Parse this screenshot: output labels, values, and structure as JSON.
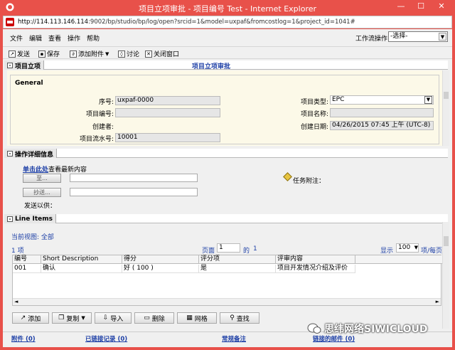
{
  "window": {
    "title": "项目立项审批 - 项目编号 Test - Internet Explorer",
    "minimize": "—",
    "restore": "☐",
    "close": "✕"
  },
  "address": {
    "url_host": "http://114.113.146.114",
    "url_rest": ":9002/bp/studio/bp/log/open?srcid=1&model=uxpaf&fromcostlog=1&project_id=1041#"
  },
  "menu": {
    "items": [
      "文件",
      "编辑",
      "查看",
      "操作",
      "帮助"
    ],
    "workflow_label": "工作流操作",
    "workflow_select": "-选择-"
  },
  "toolbar": {
    "send": "发送",
    "save": "保存",
    "attach": "添加附件",
    "discuss": "讨论",
    "close": "关闭窗口"
  },
  "project_section": {
    "tab": "项目立项",
    "heading": "项目立项审批",
    "group": "General"
  },
  "fields": {
    "seq_label": "序号:",
    "seq_value": "uxpaf-0000",
    "proj_no_label": "项目编号:",
    "proj_no_value": "",
    "creator_label": "创建者:",
    "creator_value": "",
    "flow_no_label": "项目流水号:",
    "flow_no_value": "10001",
    "type_label": "项目类型:",
    "type_value": "EPC",
    "name_label": "项目名称:",
    "name_value": "",
    "date_label": "创建日期:",
    "date_value": "04/26/2015 07:45 上午 (UTC-8)"
  },
  "ops_section": {
    "tab": "操作详细信息",
    "latest_link": "单击此处",
    "latest_text": "查看最新内容",
    "to_button": "至...",
    "cc_button": "抄送...",
    "send_for_label": "发送以供：",
    "task_note_label": "任务附注："
  },
  "line_items": {
    "tab": "Line Items",
    "current_view": "当前视图: 全部",
    "count": "1 项",
    "page_label": "页面",
    "page_value": "1",
    "of_label": "的",
    "of_value": "1",
    "show_label": "显示",
    "show_value": "100",
    "per_page_label": "项/每页",
    "columns": [
      "编号",
      "Short Description",
      "得分",
      "评分项",
      "评审内容"
    ],
    "rows": [
      [
        "001",
        "确认",
        "好 ( 100 )",
        "是",
        "项目开发情况介绍及评价"
      ]
    ]
  },
  "actions": {
    "add": "添加",
    "copy": "复制",
    "import": "导入",
    "delete": "删除",
    "grid": "网格",
    "find": "查找"
  },
  "links": {
    "attachments": "附件 (0)",
    "linked_records": "已链接记录 (0)",
    "notes": "常规备注",
    "linked_mail": "链接的邮件 (0)"
  },
  "watermark": {
    "text": "思纬网络SIWICLOUD"
  },
  "colors": {
    "titlebar": "#e8514a",
    "link": "#1d3fa6",
    "panel": "#fcf9e8"
  }
}
